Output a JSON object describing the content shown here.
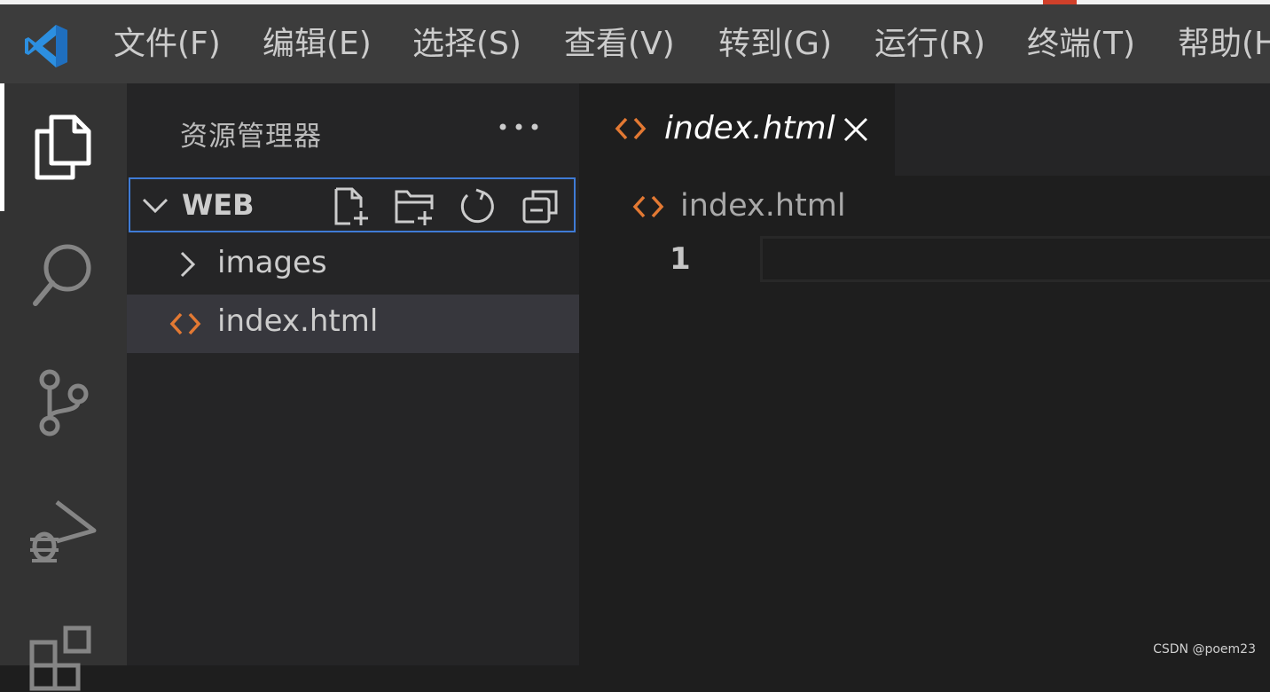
{
  "menu": {
    "items": [
      {
        "label": "文件(F)"
      },
      {
        "label": "编辑(E)"
      },
      {
        "label": "选择(S)"
      },
      {
        "label": "查看(V)"
      },
      {
        "label": "转到(G)"
      },
      {
        "label": "运行(R)"
      },
      {
        "label": "终端(T)"
      },
      {
        "label": "帮助(H)"
      }
    ]
  },
  "activity_bar": {
    "items": [
      {
        "icon": "explorer-icon",
        "active": true
      },
      {
        "icon": "search-icon"
      },
      {
        "icon": "source-control-icon"
      },
      {
        "icon": "run-debug-icon"
      },
      {
        "icon": "extensions-icon"
      }
    ]
  },
  "sidebar": {
    "title": "资源管理器",
    "more_icon": "ellipsis-icon",
    "workspace": {
      "label": "WEB",
      "actions": [
        "new-file-icon",
        "new-folder-icon",
        "refresh-icon",
        "collapse-all-icon"
      ]
    },
    "tree": [
      {
        "label": "images",
        "type": "folder",
        "icon": "chevron-right-icon"
      },
      {
        "label": "index.html",
        "type": "file",
        "icon": "html-file-icon",
        "selected": true
      }
    ]
  },
  "editor": {
    "tab": {
      "label": "index.html",
      "icon": "html-file-icon",
      "close_icon": "close-icon"
    },
    "breadcrumb": {
      "label": "index.html"
    },
    "lines": [
      {
        "number": "1",
        "text": ""
      }
    ]
  },
  "watermark": "CSDN @poem23",
  "colors": {
    "html_icon": "#e37933",
    "focus_border": "#3f7bd6",
    "vscode_blue": "#2c8fe0"
  }
}
